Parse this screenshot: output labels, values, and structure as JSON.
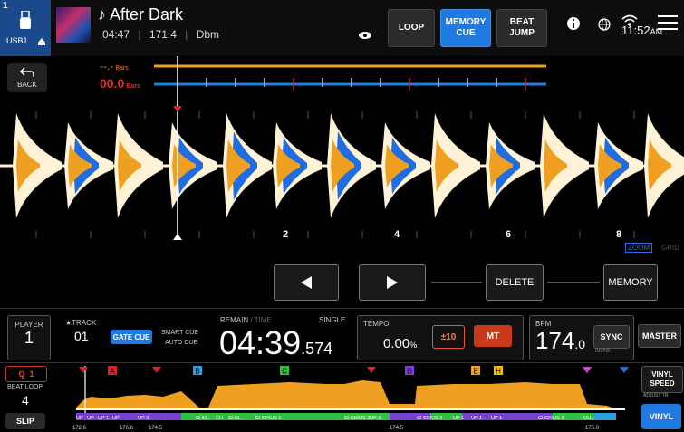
{
  "topbar": {
    "deck_number": "1",
    "source": "USB1",
    "track_title": "After Dark",
    "elapsed": "04:47",
    "bpm": "171.4",
    "key": "Dbm",
    "loop_label": "LOOP",
    "memory_cue_label": "MEMORY\nCUE",
    "beat_jump_label": "BEAT\nJUMP",
    "clock": "11:52",
    "clock_suffix": "AM"
  },
  "waveform": {
    "back_label": "BACK",
    "bars_top": "--.-",
    "bars_top_unit": "Bars",
    "bars_bottom": "00.0",
    "bars_bottom_unit": "Bars",
    "beat_numbers": [
      "2",
      "4",
      "6",
      "8"
    ],
    "zoom_label": "ZOOM",
    "grid_label": "GRID",
    "delete_label": "DELETE",
    "memory_label": "MEMORY"
  },
  "deck": {
    "player_label": "PLAYER",
    "player_number": "1",
    "track_label": "TRACK",
    "track_number": "01",
    "gate_cue_label": "GATE CUE",
    "smart_cue_label": "SMART CUE",
    "auto_cue_label": "AUTO CUE",
    "remain_label": "REMAIN",
    "time_label": "TIME",
    "single_label": "SINGLE",
    "time_main": "04:39",
    "time_fraction": ".574",
    "tempo_label": "TEMPO",
    "tempo_value": "0.00",
    "tempo_unit": "%",
    "tempo_range": "±10",
    "mt_label": "MT",
    "bpm_label": "BPM",
    "bpm_main": "174",
    "bpm_fraction": ".0",
    "sync_label": "SYNC",
    "inst_label": "INST.D.",
    "master_label": "MASTER"
  },
  "lower_left": {
    "q_label": "Q",
    "q_value": "1",
    "beat_loop_label": "BEAT LOOP",
    "beat_loop_value": "4",
    "slip_label": "SLIP"
  },
  "right_side": {
    "vinyl_speed_label": "VINYL\nSPEED",
    "adjust_label": "ADJUST TR",
    "vinyl_label": "VINYL"
  },
  "hotcues": [
    "A",
    "B",
    "C",
    "D",
    "E",
    "H"
  ],
  "phrases": [
    "UP",
    "UP",
    "UP 1",
    "UP",
    "UP 3",
    "CHO...",
    "CH",
    "CHO...",
    "CHORUS 1",
    "CHORUS 2",
    "UP 3",
    "CHORUS 2",
    "UP 1",
    "UP 1",
    "UP 1",
    "CHORUS 2",
    "OU..."
  ],
  "bpm_marks": [
    "172.6",
    "176.6",
    "174.5",
    "174.5",
    "175.0"
  ],
  "colors": {
    "accent": "#1e7ae0",
    "waveform_orange": "#f0a020",
    "waveform_blue": "#1f6de0",
    "waveform_cream": "#fff2d6",
    "cue_red": "#e0202a"
  }
}
